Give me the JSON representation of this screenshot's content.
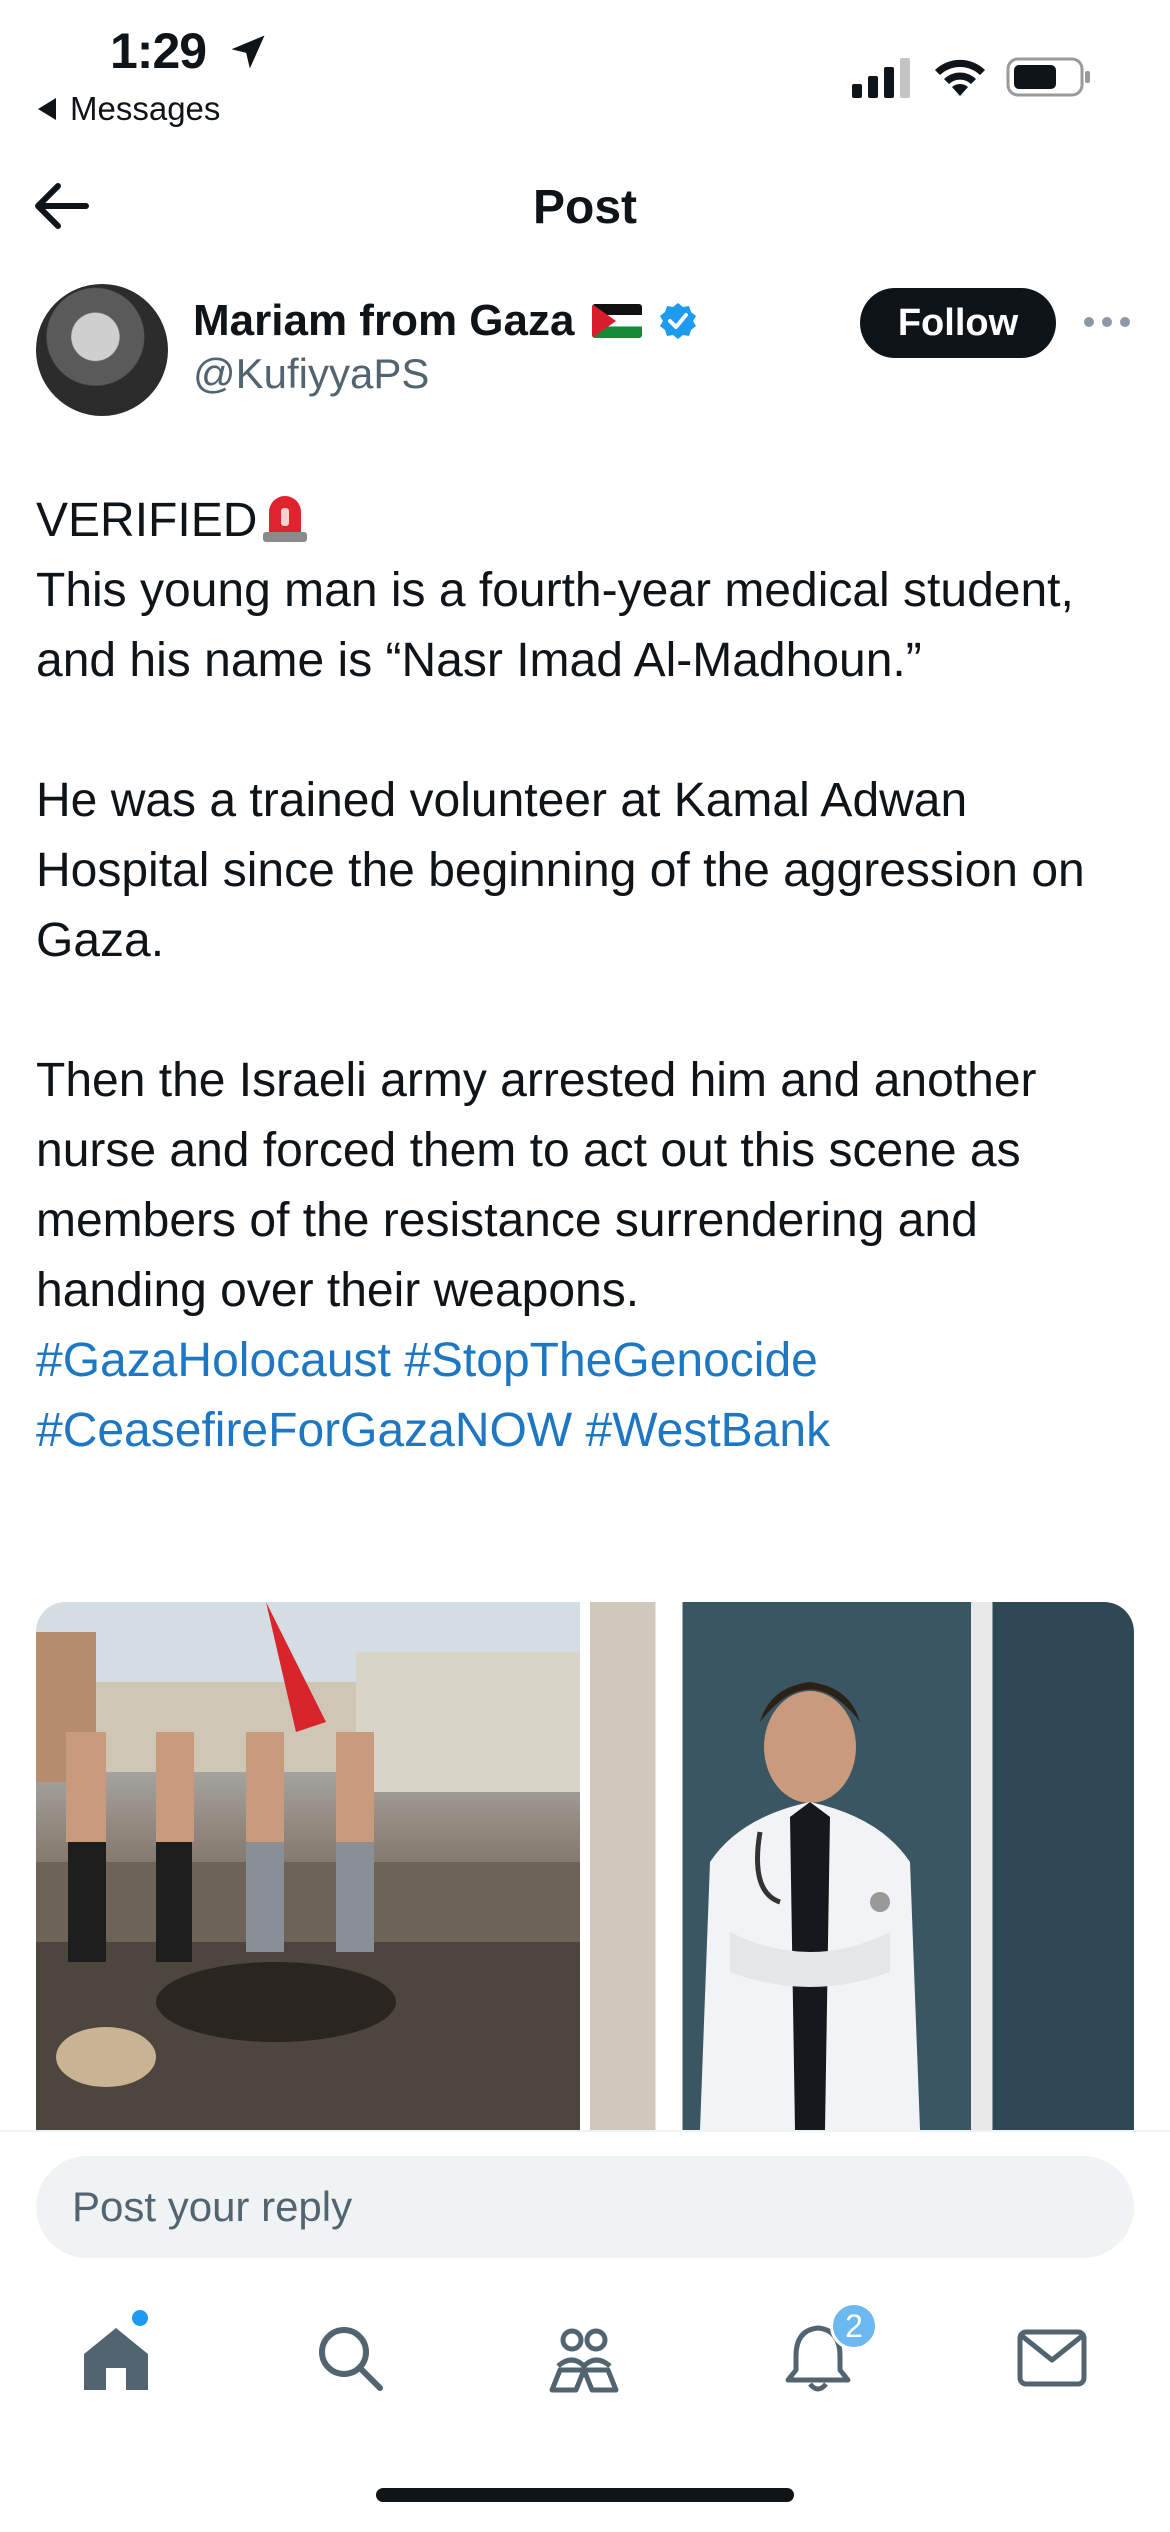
{
  "status_bar": {
    "time": "1:29",
    "back_label": "Messages",
    "icons": [
      "location-arrow-icon",
      "cellular-signal-icon",
      "wifi-icon",
      "battery-icon"
    ]
  },
  "header": {
    "title": "Post",
    "back_icon": "arrow-left-icon"
  },
  "author": {
    "name": "Mariam from Gaza",
    "handle": "@KufiyyaPS",
    "verified": true,
    "follow_label": "Follow",
    "more_icon": "more-horizontal-icon"
  },
  "post": {
    "lines": {
      "verified": "VERIFIED",
      "p1": "This young man is a fourth-year medical student, and his name is “Nasr Imad Al-Madhoun.”",
      "p2": "He was a trained volunteer at Kamal Adwan Hospital since the beginning of the aggression on Gaza.",
      "p3": "Then the Israeli army arrested him and another nurse and forced them to act out this scene as members of the resistance surrendering and handing over their weapons."
    },
    "hashtags": [
      "#GazaHolocaust",
      "#StopTheGenocide",
      "#CeasefireForGazaNOW",
      "#WestBank"
    ],
    "media": [
      "photo-men-in-rubble",
      "photo-medical-student"
    ]
  },
  "reply": {
    "placeholder": "Post your reply"
  },
  "tab_bar": {
    "items": [
      "home-icon",
      "search-icon",
      "communities-icon",
      "notifications-icon",
      "messages-icon"
    ],
    "notification_count": "2"
  },
  "colors": {
    "accent": "#1d9bf0",
    "link": "#1d77c2",
    "text": "#0f1419",
    "secondary": "#536471"
  }
}
